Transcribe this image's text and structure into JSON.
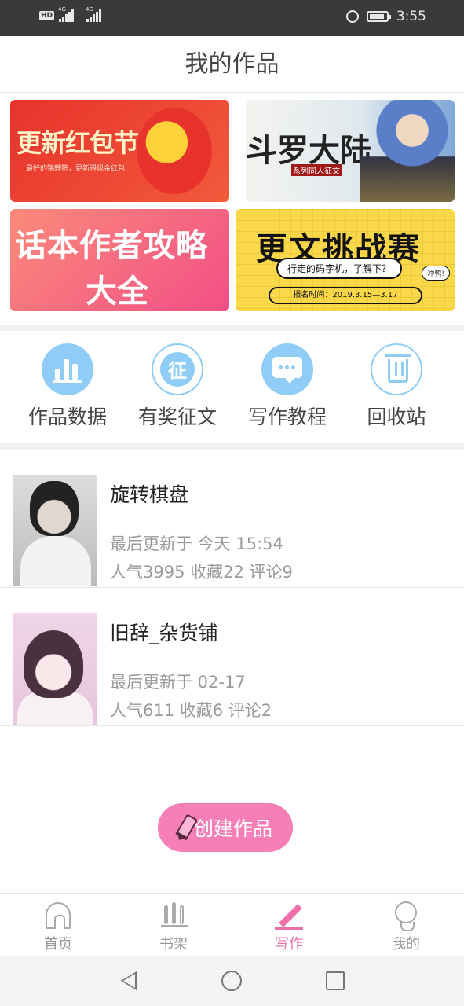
{
  "status_bar": {
    "time": "3:55",
    "hd": "HD",
    "network_1": "4G",
    "network_2": "4G"
  },
  "header": {
    "title": "我的作品"
  },
  "banners": {
    "b1": {
      "title": "更新红包节",
      "sub": "最好的锦鲤符，更新得现金红包"
    },
    "b2": {
      "title": "斗罗大陆",
      "sub": "系列同人征文"
    },
    "b3": {
      "line1": "话本作者攻略",
      "line2": "大全"
    },
    "b4": {
      "title": "更文挑战赛",
      "pill": "行走的码字机，了解下？",
      "date": "报名时间：2019.3.15—3.17",
      "badge": "冲鸭!"
    }
  },
  "tools": [
    {
      "label": "作品数据",
      "icon": "chart-icon"
    },
    {
      "label": "有奖征文",
      "icon": "contest-icon",
      "glyph": "征"
    },
    {
      "label": "写作教程",
      "icon": "chat-icon"
    },
    {
      "label": "回收站",
      "icon": "trash-icon"
    }
  ],
  "works": [
    {
      "title": "旋转棋盘",
      "updated": "最后更新于 今天 15:54",
      "stats": "人气3995 收藏22 评论9"
    },
    {
      "title": "旧辞_杂货铺",
      "updated": "最后更新于 02-17",
      "stats": "人气611 收藏6 评论2"
    }
  ],
  "create_button": {
    "label": "创建作品"
  },
  "tabbar": {
    "items": [
      {
        "label": "首页",
        "icon": "home-icon",
        "active": false
      },
      {
        "label": "书架",
        "icon": "bookshelf-icon",
        "active": false
      },
      {
        "label": "写作",
        "icon": "pen-icon",
        "active": true
      },
      {
        "label": "我的",
        "icon": "profile-icon",
        "active": false
      }
    ]
  },
  "colors": {
    "accent": "#f06fa8",
    "tool_blue": "#8fcdf7",
    "create_pink": "#f77fb7"
  }
}
